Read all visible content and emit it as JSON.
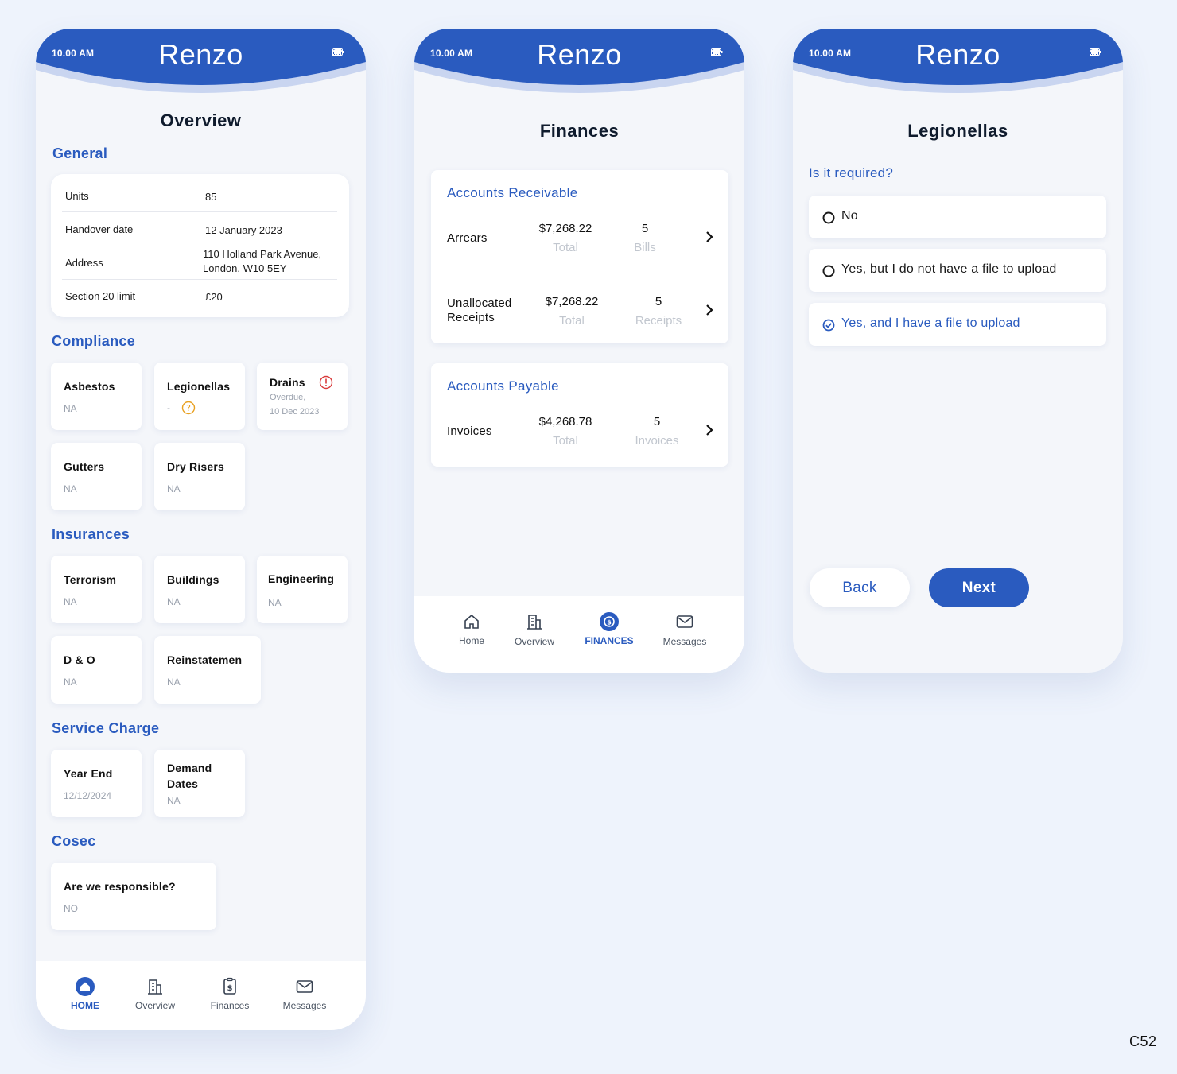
{
  "colors": {
    "brand": "#2a5bbf",
    "background": "#eef3fc",
    "alert_red": "#d93b3b",
    "warning_amber": "#e8a020"
  },
  "status": {
    "time": "10.00 AM",
    "brand": "Renzo"
  },
  "overview": {
    "title": "Overview",
    "general": {
      "heading": "General",
      "rows": [
        {
          "key": "Units",
          "value": "85"
        },
        {
          "key": "Handover date",
          "value": "12 January 2023"
        },
        {
          "key": "Address",
          "value_line1": "110 Holland Park Avenue,",
          "value_line2": "London, W10 5EY"
        },
        {
          "key": "Section 20 limit",
          "value": "£20"
        }
      ]
    },
    "compliance": {
      "heading": "Compliance",
      "tiles": [
        {
          "title": "Asbestos",
          "sub": "NA"
        },
        {
          "title": "Legionellas",
          "sub": "-"
        },
        {
          "title": "Drains",
          "sub1": "Overdue,",
          "sub2": "10 Dec 2023"
        },
        {
          "title": "Gutters",
          "sub": "NA"
        },
        {
          "title": "Dry Risers",
          "sub": "NA"
        }
      ]
    },
    "insurances": {
      "heading": "Insurances",
      "tiles": [
        {
          "title": "Terrorism",
          "sub": "NA"
        },
        {
          "title": "Buildings",
          "sub": "NA"
        },
        {
          "title": "Engineering",
          "sub": "NA"
        },
        {
          "title": "D & O",
          "sub": "NA"
        },
        {
          "title": "Reinstatemen",
          "sub": "NA"
        }
      ]
    },
    "service_charge": {
      "heading": "Service Charge",
      "tiles": [
        {
          "title": "Year End",
          "sub": "12/12/2024"
        },
        {
          "title_line1": "Demand",
          "title_line2": "Dates",
          "sub": "NA"
        }
      ]
    },
    "cosec": {
      "heading": "Cosec",
      "tiles": [
        {
          "title": "Are we responsible?",
          "sub": "NO"
        }
      ]
    },
    "nav": [
      {
        "label": "HOME",
        "icon": "home-icon",
        "active": true
      },
      {
        "label": "Overview",
        "icon": "building-icon"
      },
      {
        "label": "Finances",
        "icon": "invoice-icon"
      },
      {
        "label": "Messages",
        "icon": "mail-icon"
      }
    ]
  },
  "finances": {
    "title": "Finances",
    "receivable": {
      "heading": "Accounts Receivable",
      "rows": [
        {
          "label": "Arrears",
          "amount": "$7,268.22",
          "amount_sub": "Total",
          "count": "5",
          "count_sub": "Bills"
        },
        {
          "label_line1": "Unallocated",
          "label_line2": "Receipts",
          "amount": "$7,268.22",
          "amount_sub": "Total",
          "count": "5",
          "count_sub": "Receipts"
        }
      ]
    },
    "payable": {
      "heading": "Accounts Payable",
      "rows": [
        {
          "label": "Invoices",
          "amount": "$4,268.78",
          "amount_sub": "Total",
          "count": "5",
          "count_sub": "Invoices"
        }
      ]
    },
    "nav": [
      {
        "label": "Home",
        "icon": "home-icon"
      },
      {
        "label": "Overview",
        "icon": "building-icon"
      },
      {
        "label": "FINANCES",
        "icon": "finance-icon",
        "active": true
      },
      {
        "label": "Messages",
        "icon": "mail-icon"
      }
    ]
  },
  "legionellas": {
    "title": "Legionellas",
    "question": "Is it required?",
    "options": [
      {
        "label": "No",
        "selected": false
      },
      {
        "label": "Yes, but I do not have a file to upload",
        "selected": false
      },
      {
        "label": "Yes, and I have a file to upload",
        "selected": true
      }
    ],
    "back_label": "Back",
    "next_label": "Next"
  },
  "corner_code": "C52"
}
